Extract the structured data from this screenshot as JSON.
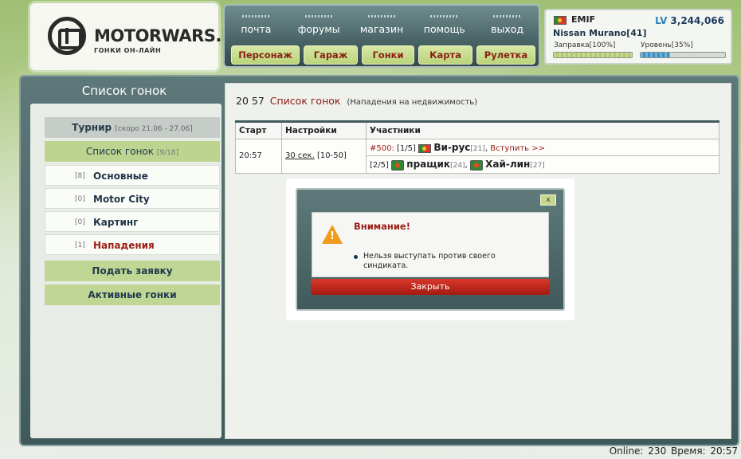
{
  "brand": {
    "name": "MOTORWARS.RU",
    "tagline": "ГОНКИ ОН-ЛАЙН"
  },
  "nav": {
    "top": [
      "почта",
      "форумы",
      "магазин",
      "помощь",
      "выход"
    ],
    "buttons": [
      "Персонаж",
      "Гараж",
      "Гонки",
      "Карта",
      "Рулетка"
    ]
  },
  "user": {
    "name": "EMIF",
    "lv_label": "LV",
    "lv_value": "3,244,066",
    "car": "Nissan Murano[41]",
    "fuel_label": "Заправка[100%]",
    "fuel_level": 1.0,
    "level_label": "Уровень[35%]",
    "level_progress": 0.35
  },
  "sidebar": {
    "title": "Список гонок",
    "tournament_label": "Турнир",
    "tournament_note": "[скоро 21.06 - 27.06]",
    "active_label": "Список гонок",
    "active_count": "[9/18]",
    "items": [
      {
        "count": "[8]",
        "label": "Основные"
      },
      {
        "count": "[0]",
        "label": "Motor City"
      },
      {
        "count": "[0]",
        "label": "Картинг"
      },
      {
        "count": "[1]",
        "label": "Нападения"
      }
    ],
    "apply_label": "Подать заявку",
    "active_races_label": "Активные гонки"
  },
  "main": {
    "time": "20 57",
    "title": "Список гонок",
    "subtitle": "(Нападения на недвижимость)",
    "table": {
      "headers": [
        "Старт",
        "Настройки",
        "Участники"
      ],
      "row": {
        "start": "20:57",
        "setting_link": "30 сек.",
        "setting_range": "[10-50]",
        "race_id": "#500:",
        "team1_slots": "[1/5]",
        "player1": "Ви-рус",
        "player1_lvl": "[21]",
        "join": "Вступить >>",
        "team2_slots": "[2/5]",
        "player2": "пращик",
        "player2_lvl": "[24]",
        "player3": "Хай-лин",
        "player3_lvl": "[27]"
      }
    }
  },
  "modal": {
    "close_symbol": "x",
    "title": "Внимание!",
    "warning_mark": "!",
    "message": "Нельзя выступать против своего синдиката.",
    "button": "Закрыть"
  },
  "status": {
    "online_label": "Online:",
    "online_value": "230",
    "time_label": "Время:",
    "time_value": "20:57"
  }
}
